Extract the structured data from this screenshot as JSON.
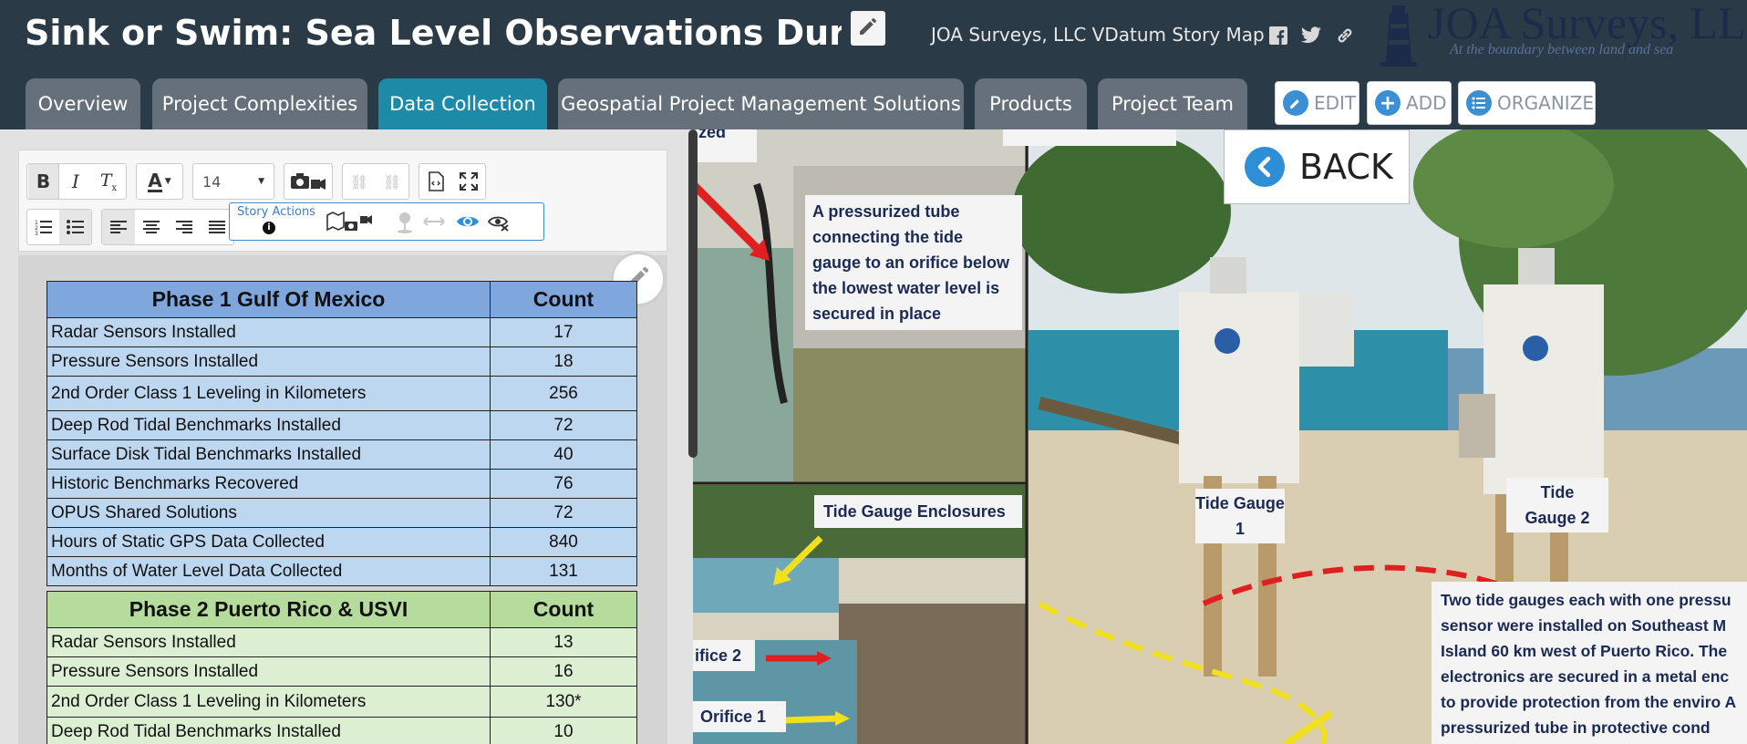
{
  "header": {
    "title": "Sink or Swim: Sea Level Observations During A Panc",
    "subtitle": "JOA Surveys, LLC VDatum Story Map",
    "logo_text": "JOA Surveys, LLC",
    "logo_tagline": "At the boundary between land and sea"
  },
  "tabs": [
    {
      "label": "Overview"
    },
    {
      "label": "Project Complexities"
    },
    {
      "label": "Data Collection"
    },
    {
      "label": "Geospatial Project Management Solutions"
    },
    {
      "label": "Products"
    },
    {
      "label": "Project Team"
    }
  ],
  "active_tab": "Data Collection",
  "builder": {
    "edit": "EDIT",
    "add": "ADD",
    "organize": "ORGANIZE"
  },
  "editor": {
    "font_size": "14",
    "story_actions_label": "Story Actions"
  },
  "phase1": {
    "heading": "Phase 1 Gulf Of Mexico",
    "count_heading": "Count",
    "rows": [
      {
        "label": "Radar Sensors Installed",
        "count": "17"
      },
      {
        "label": "Pressure Sensors Installed",
        "count": "18"
      },
      {
        "label": "2nd Order Class 1 Leveling in Kilometers",
        "count": "256"
      },
      {
        "label": "Deep Rod Tidal Benchmarks Installed",
        "count": "72"
      },
      {
        "label": "Surface Disk Tidal Benchmarks Installed",
        "count": "40"
      },
      {
        "label": "Historic Benchmarks Recovered",
        "count": "76"
      },
      {
        "label": "OPUS Shared Solutions",
        "count": "72"
      },
      {
        "label": "Hours of Static GPS Data Collected",
        "count": "840"
      },
      {
        "label": "Months of Water Level Data Collected",
        "count": "131"
      }
    ]
  },
  "phase2": {
    "heading": "Phase 2 Puerto Rico & USVI",
    "count_heading": "Count",
    "rows": [
      {
        "label": "Radar Sensors Installed",
        "count": "13"
      },
      {
        "label": "Pressure Sensors Installed",
        "count": "16"
      },
      {
        "label": "2nd Order Class 1 Leveling in Kilometers",
        "count": "130*"
      },
      {
        "label": "Deep Rod Tidal Benchmarks Installed",
        "count": "10"
      }
    ]
  },
  "media": {
    "back_label": "BACK",
    "callout_top_left": "zed",
    "callout_tube": "A pressurized tube connecting the tide gauge to an orifice below the lowest water level is secured in place",
    "callout_enclosures": "Tide Gauge Enclosures",
    "callout_orifice2": "ifice 2",
    "callout_orifice1": "Orifice 1",
    "callout_gauge1": "Tide Gauge 1",
    "callout_gauge2": "Tide Gauge 2",
    "callout_description": "Two tide gauges each with one pressu sensor were installed on Southeast M Island 60 km west of Puerto Rico. The electronics are secured in a metal enc to provide protection from the enviro A pressurized tube in protective cond"
  },
  "colors": {
    "header_bg": "#2b3a47",
    "tab_bg": "#66707b",
    "tab_active": "#1d8aa8",
    "phase1_header": "#7fa6dd",
    "phase1_row": "#bed7f0",
    "phase2_header": "#b5dc9d",
    "phase2_row": "#dcefd2",
    "accent_blue": "#3b8fd4"
  },
  "icons": [
    "edit-icon",
    "facebook-icon",
    "twitter-icon",
    "link-icon",
    "bold-icon",
    "italic-icon",
    "clear-format-icon",
    "font-color-icon",
    "camera-icon",
    "unlink-icon",
    "source-icon",
    "fullscreen-icon",
    "ordered-list-icon",
    "bullet-list-icon",
    "align-left-icon",
    "align-center-icon",
    "align-right-icon",
    "justify-icon",
    "info-icon",
    "map-media-icon",
    "pin-icon",
    "arrows-icon",
    "eye-icon",
    "hide-icon",
    "back-chevron-icon"
  ]
}
